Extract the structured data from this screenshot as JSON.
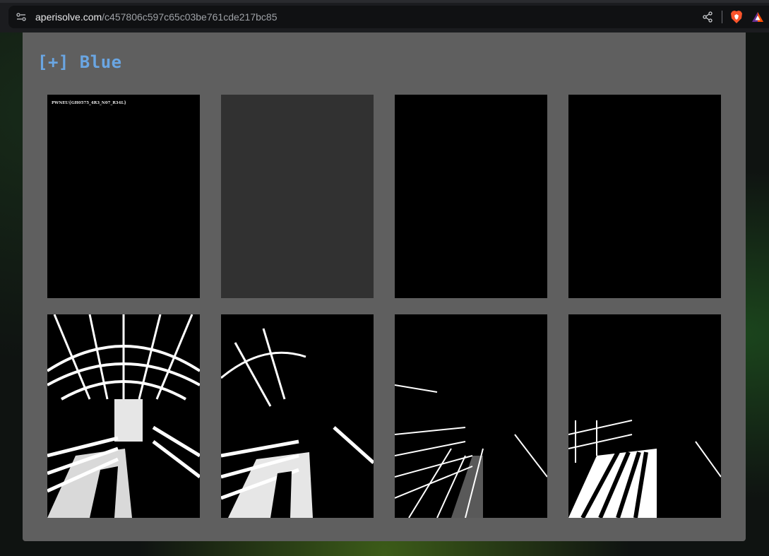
{
  "browser": {
    "url_domain": "aperisolve.com",
    "url_path": "/c457806c597c65c03be761cde217bc85"
  },
  "panel": {
    "title": "[+] Blue",
    "thumbnails": [
      {
        "id": "bit-7",
        "text": "PWNEU{GH0575_4R3_N07_R34L}"
      },
      {
        "id": "bit-6",
        "text": ""
      },
      {
        "id": "bit-5",
        "text": ""
      },
      {
        "id": "bit-4",
        "text": ""
      },
      {
        "id": "bit-3",
        "text": ""
      },
      {
        "id": "bit-2",
        "text": ""
      },
      {
        "id": "bit-1",
        "text": ""
      },
      {
        "id": "bit-0",
        "text": ""
      }
    ]
  },
  "colors": {
    "title": "#6aa6e3",
    "panel_bg": "#5f5f5f",
    "brave_orange": "#fb542b"
  },
  "icons": [
    "site-settings-icon",
    "share-icon",
    "brave-shield-icon",
    "brave-rewards-icon"
  ]
}
